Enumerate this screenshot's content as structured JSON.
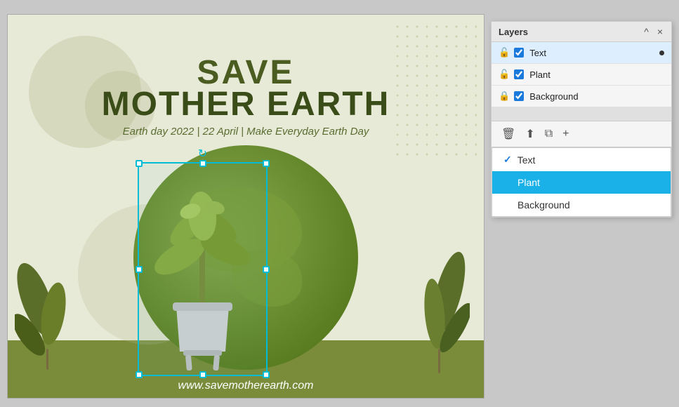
{
  "window": {
    "title": "Layers",
    "close_label": "×",
    "minimize_label": "^"
  },
  "canvas": {
    "title_line1": "SAVE",
    "title_line2": "MOTHER EARTH",
    "subtitle": "Earth day 2022 | 22 April | Make Everyday Earth Day",
    "url": "www.savemotherearth.com"
  },
  "layers_panel": {
    "title": "Layers",
    "items": [
      {
        "id": "text",
        "label": "Text",
        "checked": true,
        "active": true,
        "locked": false,
        "has_dot": true
      },
      {
        "id": "plant",
        "label": "Plant",
        "checked": true,
        "active": false,
        "locked": false,
        "has_dot": false
      },
      {
        "id": "background",
        "label": "Background",
        "checked": true,
        "active": false,
        "locked": true,
        "has_dot": false
      }
    ],
    "toolbar": {
      "delete_icon": "🗑",
      "export_icon": "⬆",
      "copy_icon": "⧉",
      "add_icon": "+"
    },
    "dropdown": {
      "items": [
        {
          "id": "text",
          "label": "Text",
          "checked": true,
          "highlighted": false
        },
        {
          "id": "plant",
          "label": "Plant",
          "checked": false,
          "highlighted": true
        },
        {
          "id": "background",
          "label": "Background",
          "checked": false,
          "highlighted": false
        }
      ]
    }
  }
}
